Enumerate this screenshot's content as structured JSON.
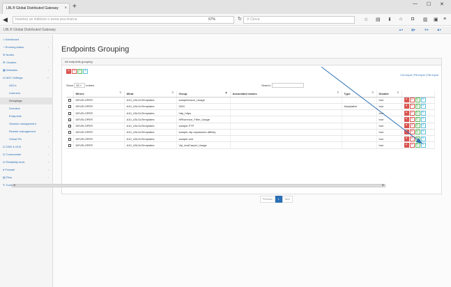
{
  "browser": {
    "tab_title": "LBL® Global Distributed Gateway",
    "tab_close": "×",
    "new_tab": "+",
    "url_placeholder": "Inserisci un indirizzo o avvia una ricerca",
    "zoom": "67%",
    "search_placeholder": "Cerca"
  },
  "app": {
    "header": "LBL® Global Distributed Gateway",
    "page_title": "Endpoints Grouping"
  },
  "sidebar": {
    "items": [
      {
        "label": "Dashboard"
      },
      {
        "label": "Running status"
      },
      {
        "label": "Nodes"
      },
      {
        "label": "Clusters"
      },
      {
        "label": "Websites"
      },
      {
        "label": "ADC Settings"
      },
      {
        "label": "ADCs"
      },
      {
        "label": "Listeners"
      },
      {
        "label": "Groupings"
      },
      {
        "label": "Domains"
      },
      {
        "label": "Endpoints"
      },
      {
        "label": "Session management"
      },
      {
        "label": "Rewrite management"
      },
      {
        "label": "Virtual IPs"
      },
      {
        "label": "DNS & GLB"
      },
      {
        "label": "Commander"
      },
      {
        "label": "Reliability tools"
      },
      {
        "label": "Firewall"
      },
      {
        "label": "Files"
      },
      {
        "label": "Tools"
      }
    ]
  },
  "panel": {
    "heading": "All endpoints grouping",
    "exports": "Cvs export  |  Pdf export  |  File export",
    "show_label": "Show",
    "show_value": "25",
    "entries_label": "entries",
    "search_label": "Search:"
  },
  "table": {
    "columns": [
      "",
      "Where",
      "What",
      "Group",
      "Associated names",
      "Type",
      "Disable",
      ""
    ],
    "rows": [
      {
        "where": "DEVELOPER",
        "what": "A10_LBLGoTemplates",
        "group": "sampleesson_Usage",
        "assoc": "",
        "type": "",
        "disable": "true"
      },
      {
        "where": "DEVELOPER",
        "what": "A10_LBLGoTemplates",
        "group": "DNS",
        "assoc": "",
        "type": "Adaptative",
        "disable": "true"
      },
      {
        "where": "DEVELOPER",
        "what": "A10_LBLGoTemplates",
        "group": "http_https",
        "assoc": "",
        "type": "",
        "disable": "true"
      },
      {
        "where": "DEVELOPER",
        "what": "A10_LBLGoTemplates",
        "group": "HRIservice_Filter_Usage",
        "assoc": "",
        "type": "",
        "disable": "true"
      },
      {
        "where": "DEVELOPER",
        "what": "A10_LBLGoTemplates",
        "group": "sample-FTP",
        "assoc": "",
        "type": "",
        "disable": "true"
      },
      {
        "where": "DEVELOPER",
        "what": "A10_LBLGoTemplates",
        "group": "sample-ntp-mysession-affinity",
        "assoc": "",
        "type": "",
        "disable": "true"
      },
      {
        "where": "DEVELOPER",
        "what": "A10_LBLGoTemplates",
        "group": "sample-solr",
        "assoc": "",
        "type": "",
        "disable": "true"
      },
      {
        "where": "DEVELOPER",
        "what": "A10_LBLGoTemplates",
        "group": "Vip_testCarpet_Usage",
        "assoc": "",
        "type": "",
        "disable": "true"
      }
    ]
  },
  "pagination": {
    "previous": "Previous",
    "page": "1",
    "next": "Next"
  },
  "icons": [
    "back-arrow-icon",
    "reload-icon",
    "search-icon",
    "star-icon",
    "bookmark-icon",
    "download-icon",
    "home-icon",
    "pocket-icon",
    "library-icon",
    "menu-icon"
  ],
  "colors": {
    "link": "#2a6fb5",
    "danger": "#d9534f",
    "success": "#5cb85c",
    "info": "#5bc0de",
    "annotation_line": "#2a6fb5"
  }
}
